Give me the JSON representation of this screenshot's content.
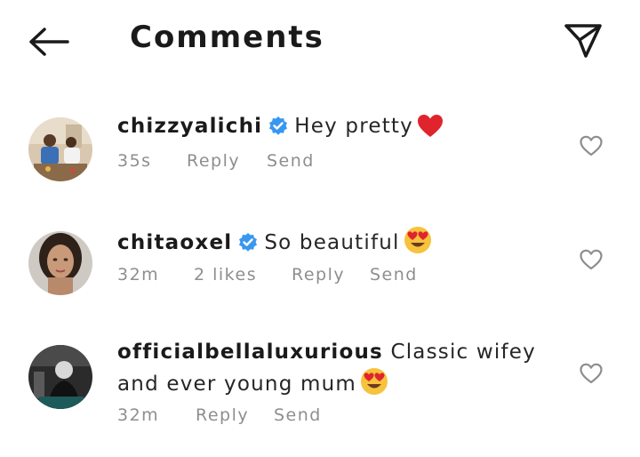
{
  "header": {
    "title": "Comments",
    "back_icon": "arrow-left-icon",
    "send_icon": "paper-plane-icon"
  },
  "comments": [
    {
      "username": "chizzyalichi",
      "verified": true,
      "text": "Hey pretty",
      "emoji": "red-heart",
      "time": "35s",
      "likes": "",
      "reply_label": "Reply",
      "send_label": "Send"
    },
    {
      "username": "chitaoxel",
      "verified": true,
      "text": "So beautiful",
      "emoji": "heart-eyes",
      "time": "32m",
      "likes": "2 likes",
      "reply_label": "Reply",
      "send_label": "Send"
    },
    {
      "username": "officialbellaluxurious",
      "verified": false,
      "text": "Classic wifey and ever young mum",
      "emoji": "heart-eyes",
      "time": "32m",
      "likes": "",
      "reply_label": "Reply",
      "send_label": "Send"
    }
  ],
  "colors": {
    "verified_badge": "#3897f0",
    "meta_text": "#8e8e8e",
    "heart_red": "#ed4956"
  }
}
